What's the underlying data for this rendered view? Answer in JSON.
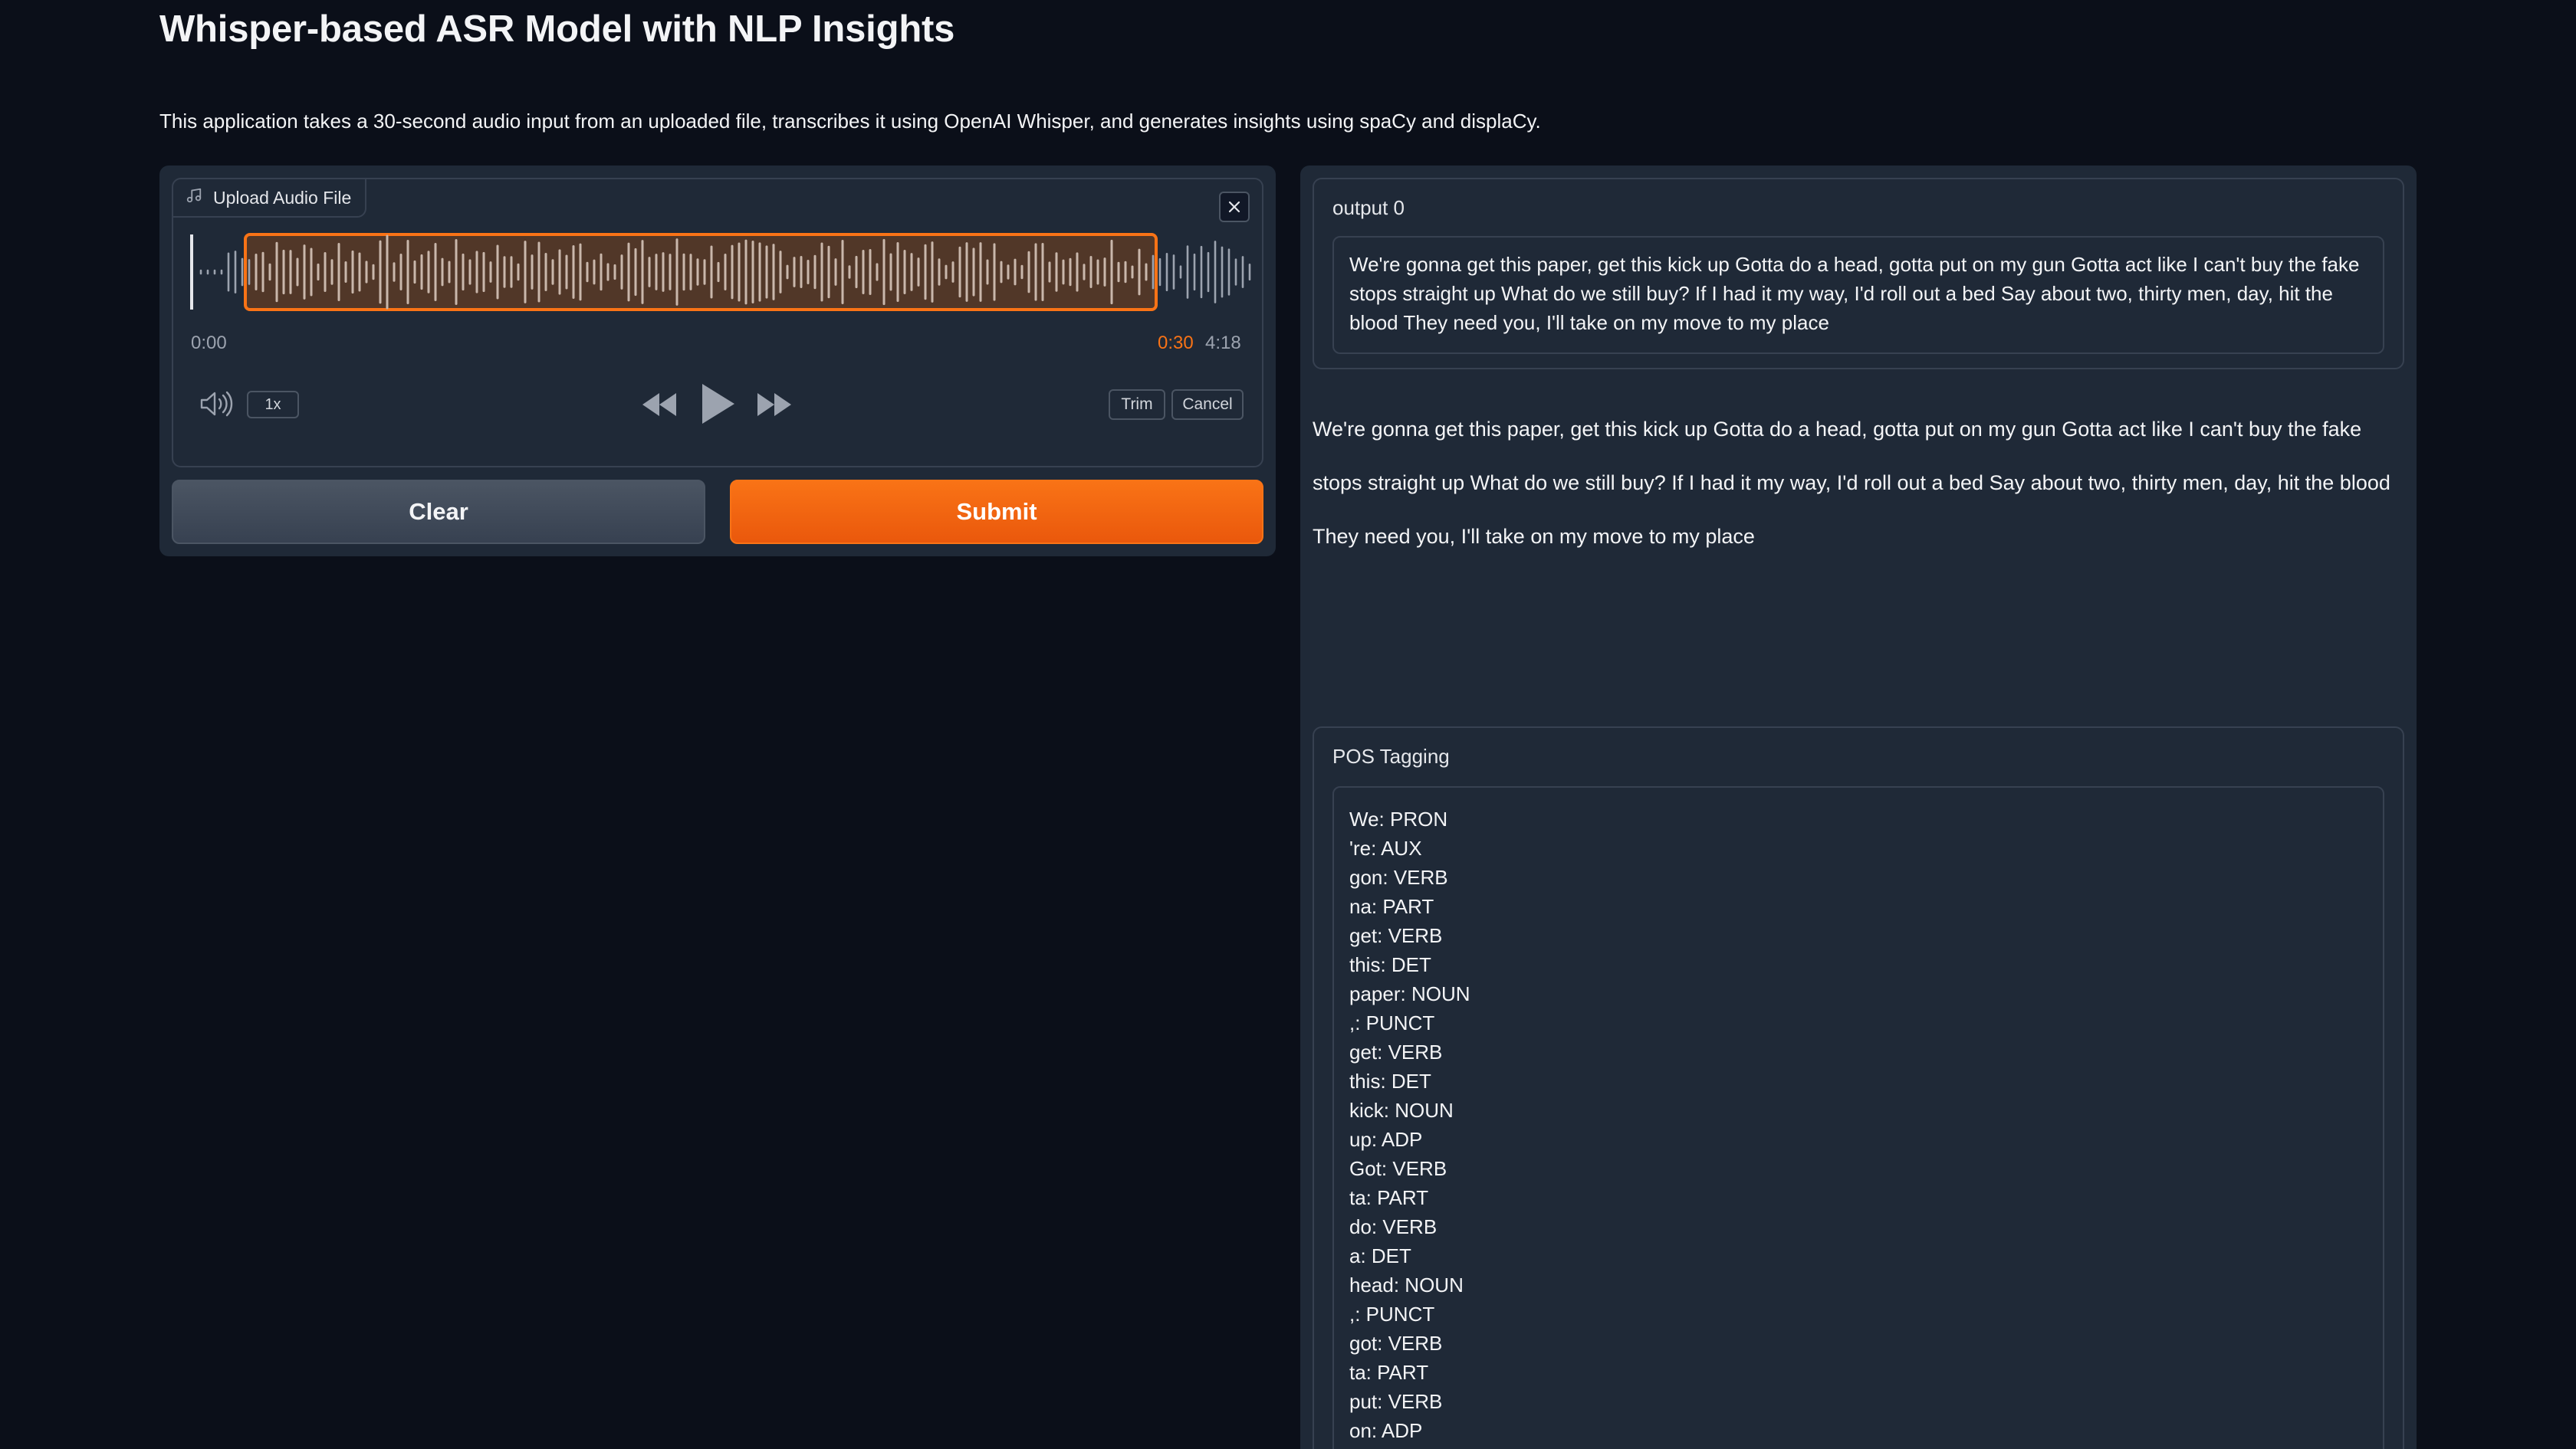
{
  "header": {
    "title": "Whisper-based ASR Model with NLP Insights",
    "description": "This application takes a 30-second audio input from an uploaded file, transcribes it using OpenAI Whisper, and generates insights using spaCy and displaCy."
  },
  "audio_input": {
    "label": "Upload Audio File",
    "label_icon": "music-note-icon",
    "time_start": "0:00",
    "time_selection_end": "0:30",
    "time_total": "4:18",
    "playback_rate": "1x",
    "trim_label": "Trim",
    "cancel_label": "Cancel",
    "accent_color": "#f97316"
  },
  "actions": {
    "clear_label": "Clear",
    "submit_label": "Submit"
  },
  "output0": {
    "label": "output 0",
    "text": "We're gonna get this paper, get this kick up Gotta do a head, gotta put on my gun Gotta act like I can't buy the fake stops straight up What do we still buy? If I had it my way, I'd roll out a bed Say about two, thirty men, day, hit the blood They need you, I'll take on my move to my place"
  },
  "html_output": {
    "text": "We're gonna get this paper, get this kick up Gotta do a head, gotta put on my gun Gotta act like I can't buy the fake stops straight up What do we still buy? If I had it my way, I'd roll out a bed Say about two, thirty men, day, hit the blood They need you, I'll take on my move to my place"
  },
  "pos_tagging": {
    "label": "POS Tagging",
    "lines": [
      "We: PRON",
      "'re: AUX",
      "gon: VERB",
      "na: PART",
      "get: VERB",
      "this: DET",
      "paper: NOUN",
      ",: PUNCT",
      "get: VERB",
      "this: DET",
      "kick: NOUN",
      "up: ADP",
      "Got: VERB",
      "ta: PART",
      "do: VERB",
      "a: DET",
      "head: NOUN",
      ",: PUNCT",
      "got: VERB",
      "ta: PART",
      "put: VERB",
      "on: ADP"
    ]
  }
}
